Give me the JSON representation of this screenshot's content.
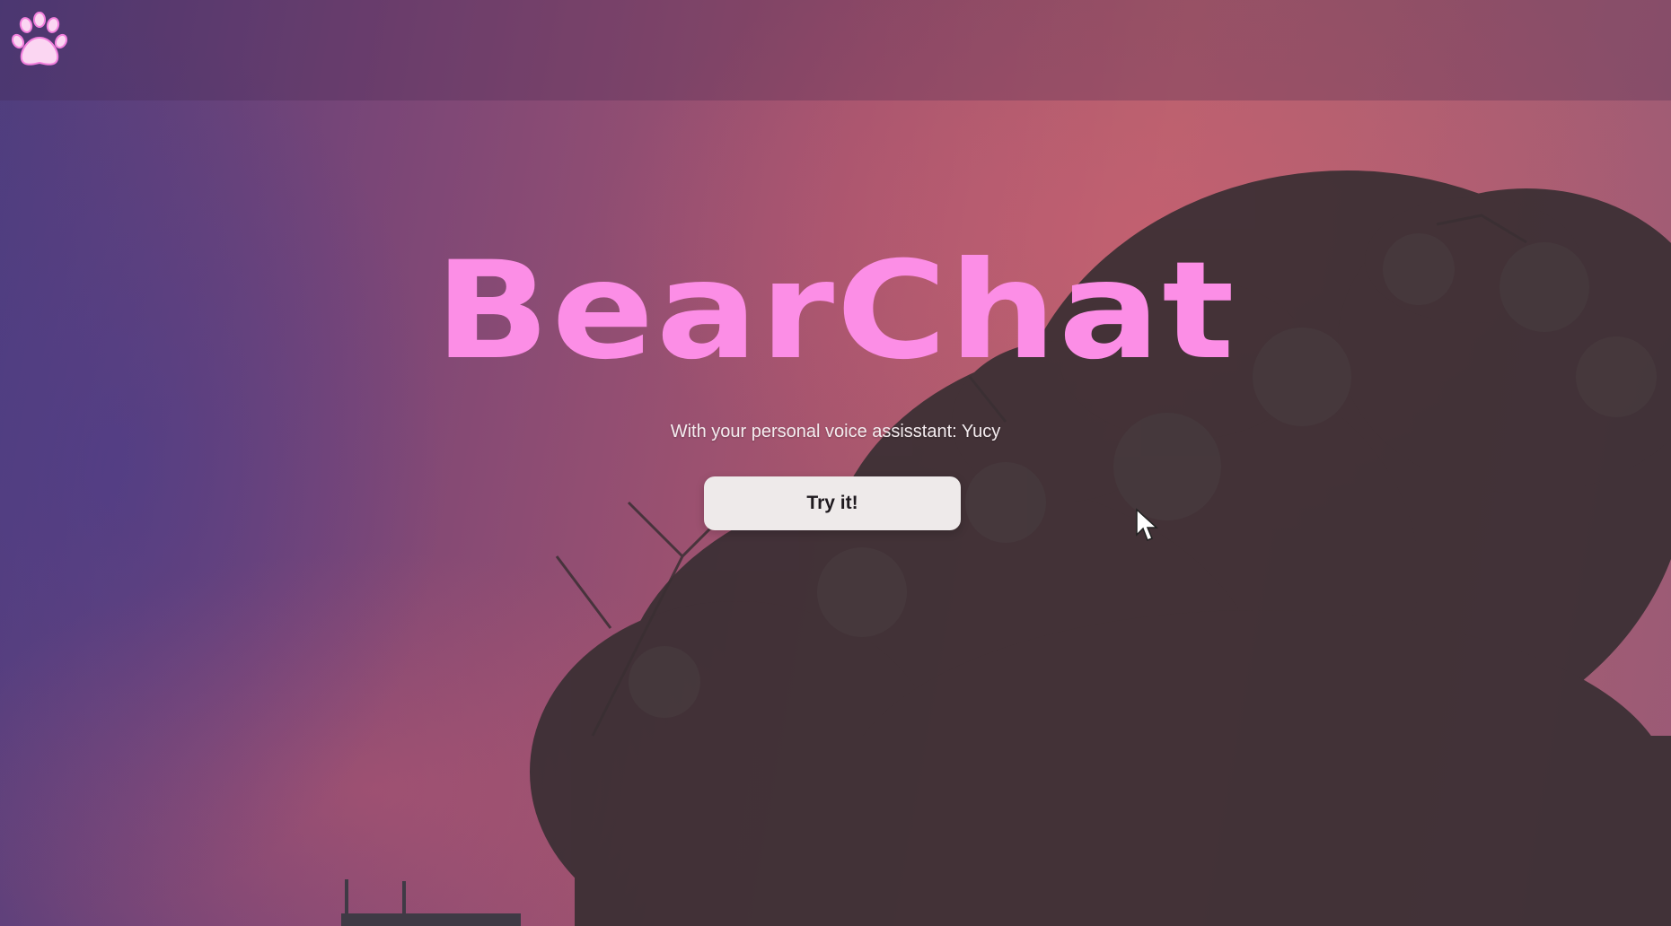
{
  "header": {
    "logo_icon": "paw-icon"
  },
  "hero": {
    "title": "BearChat",
    "subtitle": "With your personal voice assisstant: Yucy",
    "cta_label": "Try it!"
  },
  "colors": {
    "title_pink": "#fc8ee6",
    "button_bg": "#eeeaea",
    "button_text": "#1f1a1f",
    "sky_purple": "#4e3d7e",
    "sky_rose": "#b5626d"
  }
}
